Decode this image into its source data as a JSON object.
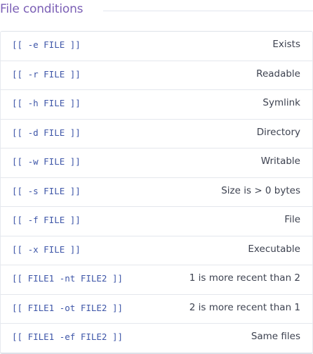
{
  "section": {
    "title": "File conditions"
  },
  "rows": [
    {
      "code": "[[ -e FILE ]]",
      "desc": "Exists"
    },
    {
      "code": "[[ -r FILE ]]",
      "desc": "Readable"
    },
    {
      "code": "[[ -h FILE ]]",
      "desc": "Symlink"
    },
    {
      "code": "[[ -d FILE ]]",
      "desc": "Directory"
    },
    {
      "code": "[[ -w FILE ]]",
      "desc": "Writable"
    },
    {
      "code": "[[ -s FILE ]]",
      "desc": "Size is > 0 bytes"
    },
    {
      "code": "[[ -f FILE ]]",
      "desc": "File"
    },
    {
      "code": "[[ -x FILE ]]",
      "desc": "Executable"
    },
    {
      "code": "[[ FILE1 -nt FILE2 ]]",
      "desc": "1 is more recent than 2"
    },
    {
      "code": "[[ FILE1 -ot FILE2 ]]",
      "desc": "2 is more recent than 1"
    },
    {
      "code": "[[ FILE1 -ef FILE2 ]]",
      "desc": "Same files"
    }
  ],
  "colors": {
    "title": "#7b5fb5",
    "code": "#3e56a8",
    "text": "#3d4250",
    "border": "#e4e7ed"
  }
}
